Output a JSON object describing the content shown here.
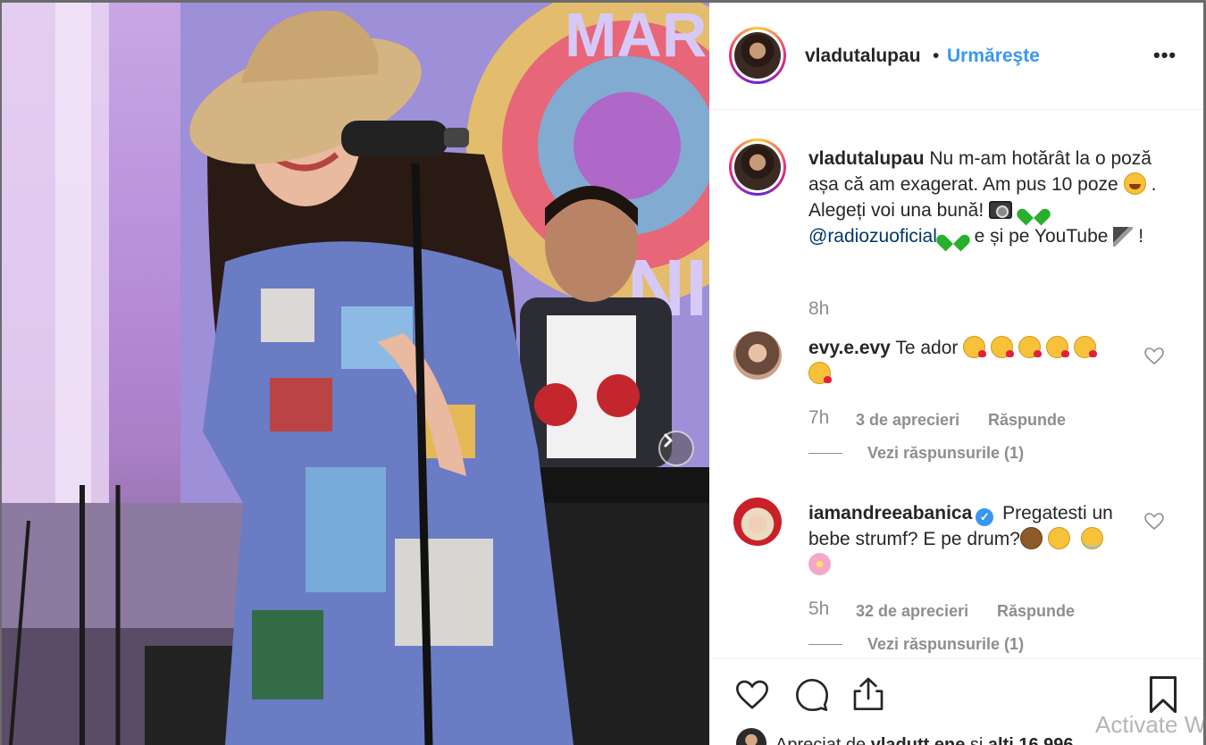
{
  "post": {
    "username": "vladutalupau",
    "separator": "•",
    "follow_label": "Urmăreşte",
    "more_label": "•••",
    "caption": {
      "username": "vladutalupau",
      "text_1": "Nu m-am hotărât la o poză așa că am exagerat. Am pus 10 poze",
      "text_2": ". Alegeți voi una bună!",
      "mention": "@radiozuoficial",
      "text_3": "e și pe YouTube",
      "text_4": "!"
    },
    "caption_time": "8h"
  },
  "comments": [
    {
      "username": "evy.e.evy",
      "text": "Te ador",
      "time": "7h",
      "likes": "3 de aprecieri",
      "reply_label": "Răspunde",
      "view_replies": "Vezi răspunsurile (1)"
    },
    {
      "username": "iamandreeabanica",
      "verified_mark": "✓",
      "text": "Pregatesti un bebe strumf? E pe drum?",
      "time": "5h",
      "likes": "32 de aprecieri",
      "reply_label": "Răspunde",
      "view_replies": "Vezi răspunsurile (1)"
    }
  ],
  "footer": {
    "liked_by_prefix": "Apreciat de",
    "liked_by_user": "vladutt.ene",
    "liked_by_and": "și",
    "liked_by_rest": "alți 16.996"
  },
  "watermark": "Activate W",
  "icons": {
    "next": "chevron-right-icon",
    "like": "heart-icon",
    "comment": "comment-bubble-icon",
    "share": "share-upload-icon",
    "save": "bookmark-icon"
  },
  "colors": {
    "link_blue": "#3897f0",
    "mention_blue": "#00376b",
    "muted_gray": "#8e8e8e",
    "text": "#262626"
  }
}
